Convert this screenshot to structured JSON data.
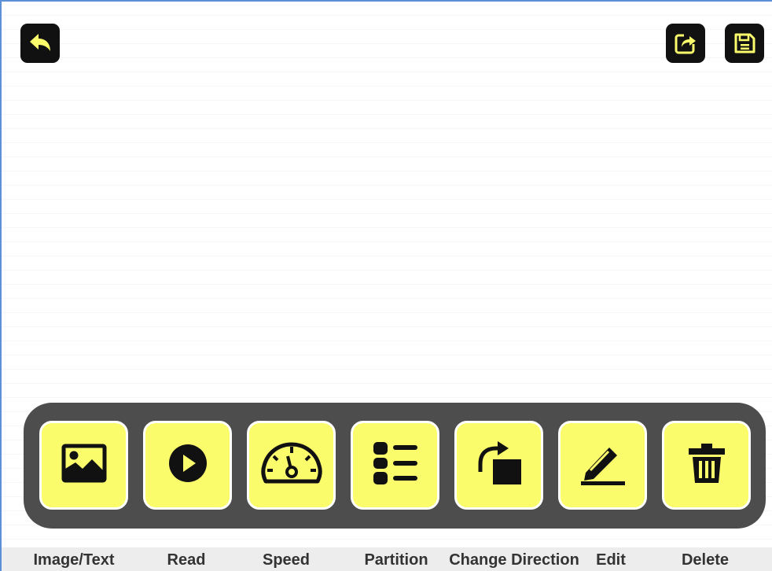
{
  "header": {
    "back_icon": "undo-arrow-icon",
    "share_icon": "share-icon",
    "save_icon": "floppy-disk-icon"
  },
  "colors": {
    "accent_yellow": "#fbfc6b",
    "toolbar_gray": "#4d4d4d",
    "button_black": "#111111",
    "label_bar": "#ededed"
  },
  "toolbar": {
    "items": [
      {
        "label": "Image/Text",
        "icon": "image-icon"
      },
      {
        "label": "Read",
        "icon": "play-icon"
      },
      {
        "label": "Speed",
        "icon": "speedometer-icon"
      },
      {
        "label": "Partition",
        "icon": "list-icon"
      },
      {
        "label": "Change Direction",
        "icon": "rotate-icon"
      },
      {
        "label": "Edit",
        "icon": "pencil-icon"
      },
      {
        "label": "Delete",
        "icon": "trash-icon"
      }
    ]
  }
}
